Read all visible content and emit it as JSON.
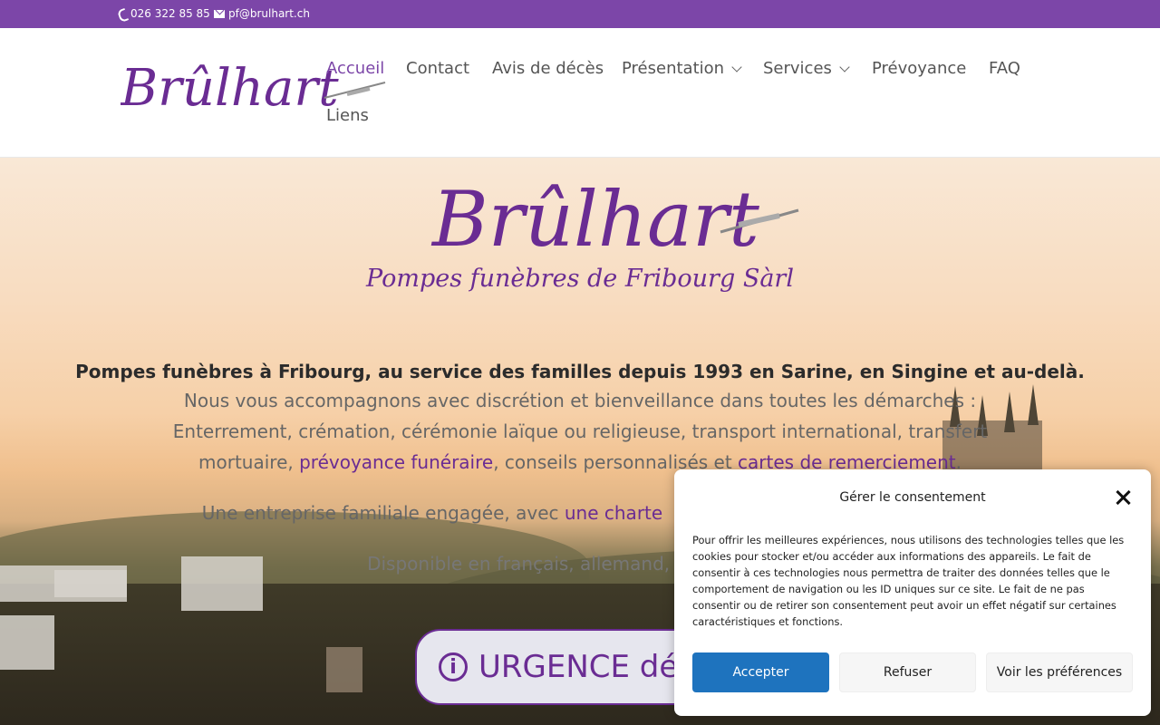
{
  "topbar": {
    "phone": "026 322 85 85",
    "email": "pf@brulhart.ch"
  },
  "brand": {
    "logo_text": "Brûlhart",
    "tagline": "Pompes funèbres de Fribourg Sàrl"
  },
  "nav": {
    "items": [
      {
        "label": "Accueil"
      },
      {
        "label": "Contact"
      },
      {
        "label": "Avis de décès"
      },
      {
        "label": "Présentation"
      },
      {
        "label": "Services"
      },
      {
        "label": "Prévoyance"
      },
      {
        "label": "FAQ"
      },
      {
        "label": "Liens"
      }
    ]
  },
  "hero": {
    "headline": "Pompes funèbres à Fribourg, au service des familles depuis 1993 en Sarine, en Singine et au-delà.",
    "line1": "Nous vous accompagnons avec discrétion et bienveillance dans toutes les démarches :",
    "line2": "Enterrement, crémation, cérémonie laïque ou religieuse, transport international, transfert",
    "line3_a": "mortuaire, ",
    "line3_link1": "prévoyance funéraire",
    "line3_b": ", conseils personnalisés et ",
    "line3_link2": "cartes de remerciement",
    "line3_c": ".",
    "line4_a": "Une entreprise familiale engagée, avec ",
    "line4_link": "une charte",
    "line5": "Disponible en français, allemand, it",
    "urgence": "URGENCE déc"
  },
  "consent": {
    "title": "Gérer le consentement",
    "body": "Pour offrir les meilleures expériences, nous utilisons des technologies telles que les cookies pour stocker et/ou accéder aux informations des appareils. Le fait de consentir à ces technologies nous permettra de traiter des données telles que le comportement de navigation ou les ID uniques sur ce site. Le fait de ne pas consentir ou de retirer son consentement peut avoir un effet négatif sur certaines caractéristiques et fonctions.",
    "accept": "Accepter",
    "refuse": "Refuser",
    "prefs": "Voir les préférences"
  },
  "colors": {
    "brand_purple": "#7c46a8",
    "link_purple": "#6a2c93",
    "accept_blue": "#1e73be"
  }
}
